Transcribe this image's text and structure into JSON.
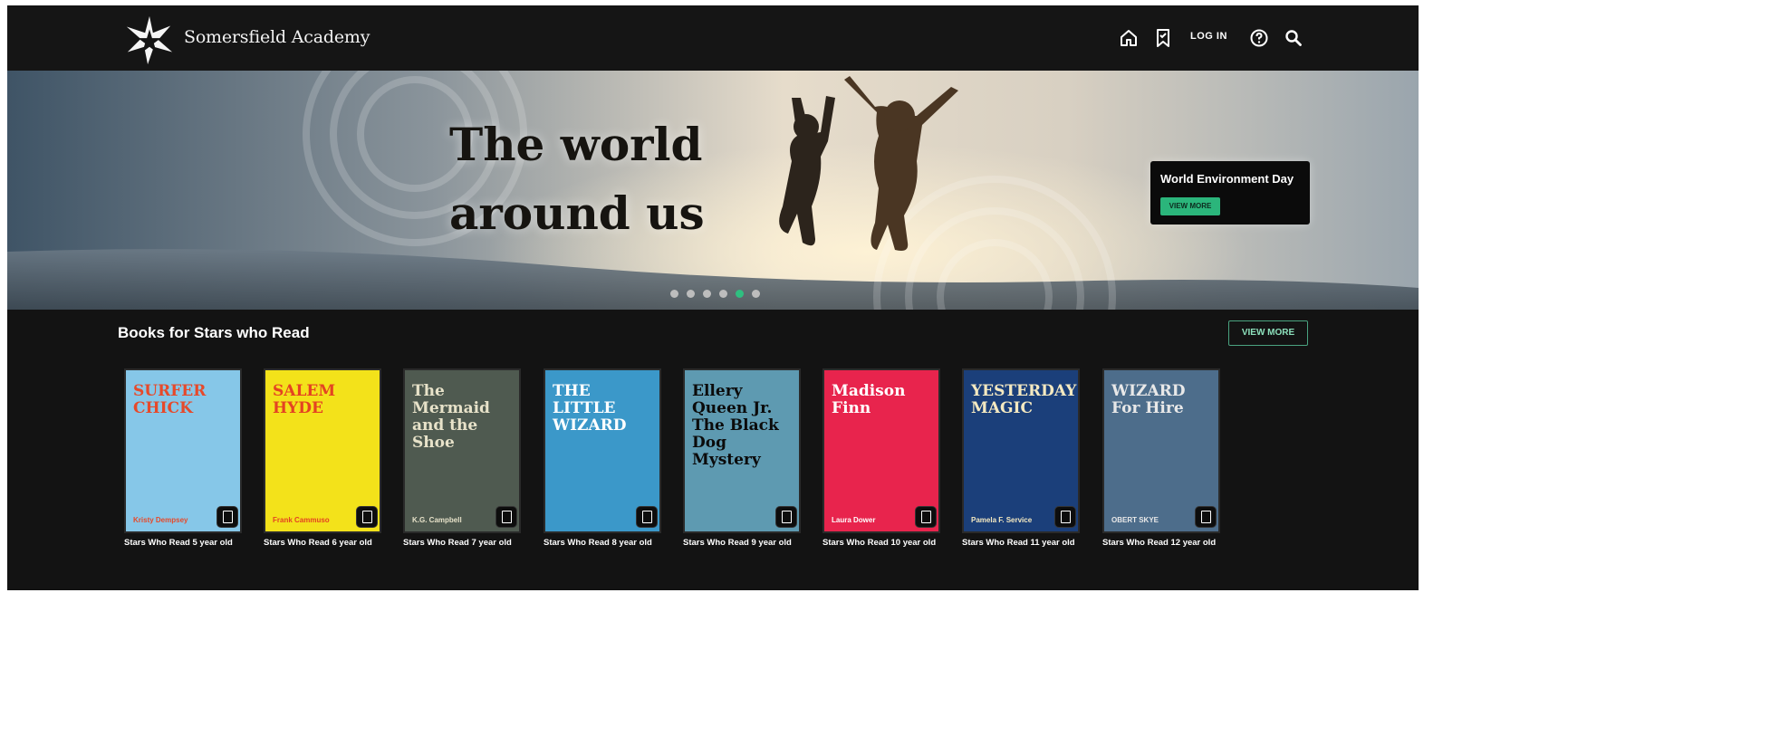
{
  "header": {
    "brand": "Somersfield Academy",
    "nav": {
      "home_icon": "home-icon",
      "bookmark_icon": "bookmark-icon",
      "login_label": "LOG IN",
      "help_icon": "help-icon",
      "search_icon": "search-icon"
    }
  },
  "hero": {
    "headline_line1": "The world",
    "headline_line2": "around us",
    "promo_title": "World Environment Day",
    "promo_button": "VIEW MORE",
    "slide_count": 6,
    "active_slide": 5
  },
  "books_section": {
    "title": "Books for Stars who Read",
    "view_more": "VIEW MORE",
    "books": [
      {
        "label": "Stars Who Read 5 year old",
        "cover_title": "SURFER CHICK",
        "cover_author": "Kristy Dempsey",
        "bg": "#86c7e8",
        "fg": "#e6492a"
      },
      {
        "label": "Stars Who Read 6 year old",
        "cover_title": "SALEM HYDE",
        "cover_author": "Frank Cammuso",
        "bg": "#f3e21a",
        "fg": "#e44322"
      },
      {
        "label": "Stars Who Read 7 year old",
        "cover_title": "The Mermaid and the Shoe",
        "cover_author": "K.G. Campbell",
        "bg": "#4f5a50",
        "fg": "#e7e2c9"
      },
      {
        "label": "Stars Who Read 8 year old",
        "cover_title": "THE LITTLE WIZARD",
        "cover_author": "",
        "bg": "#3b98c9",
        "fg": "#ffffff"
      },
      {
        "label": "Stars Who Read 9 year old",
        "cover_title": "Ellery Queen Jr. The Black Dog Mystery",
        "cover_author": "",
        "bg": "#5e9ab1",
        "fg": "#0b0b0b"
      },
      {
        "label": "Stars Who Read 10 year old",
        "cover_title": "Madison Finn",
        "cover_author": "Laura Dower",
        "bg": "#e8244d",
        "fg": "#ffffff"
      },
      {
        "label": "Stars Who Read 11 year old",
        "cover_title": "YESTERDAY'S MAGIC",
        "cover_author": "Pamela F. Service",
        "bg": "#1b3f7a",
        "fg": "#f4e9c1"
      },
      {
        "label": "Stars Who Read 12 year old",
        "cover_title": "WIZARD For Hire",
        "cover_author": "OBERT SKYE",
        "bg": "#4d6d8b",
        "fg": "#e8e8e8"
      }
    ],
    "book_badge_icon": "book-icon"
  },
  "colors": {
    "accent_green": "#2bb57b",
    "background": "#131313"
  }
}
